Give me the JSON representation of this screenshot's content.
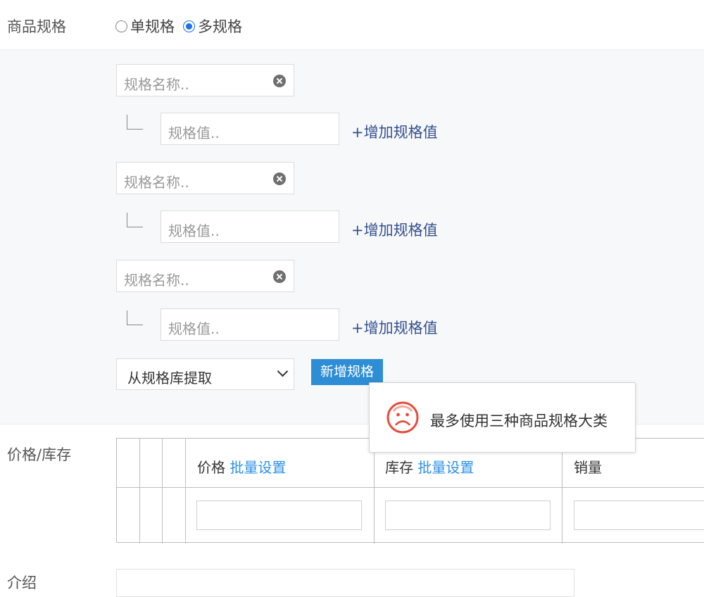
{
  "spec": {
    "label": "商品规格",
    "single_label": "单规格",
    "multi_label": "多规格",
    "selected": "multi",
    "groups": [
      {
        "name_placeholder": "规格名称..",
        "value_placeholder": "规格值..",
        "add_value_label": "+增加规格值"
      },
      {
        "name_placeholder": "规格名称..",
        "value_placeholder": "规格值..",
        "add_value_label": "+增加规格值"
      },
      {
        "name_placeholder": "规格名称..",
        "value_placeholder": "规格值..",
        "add_value_label": "+增加规格值"
      }
    ],
    "library_select": "从规格库提取",
    "add_spec_button": "新增规格"
  },
  "toast": {
    "message": "最多使用三种商品规格大类",
    "icon": "sad-face-icon",
    "color": "#e74c3c"
  },
  "price_stock": {
    "label": "价格/库存",
    "columns": [
      {
        "label": "价格",
        "batch": "批量设置"
      },
      {
        "label": "库存",
        "batch": "批量设置"
      },
      {
        "label": "销量"
      }
    ]
  },
  "intro": {
    "label": "介绍"
  },
  "colors": {
    "accent": "#2d8ed5",
    "link": "#2b8fe6",
    "add_link": "#33508f"
  }
}
